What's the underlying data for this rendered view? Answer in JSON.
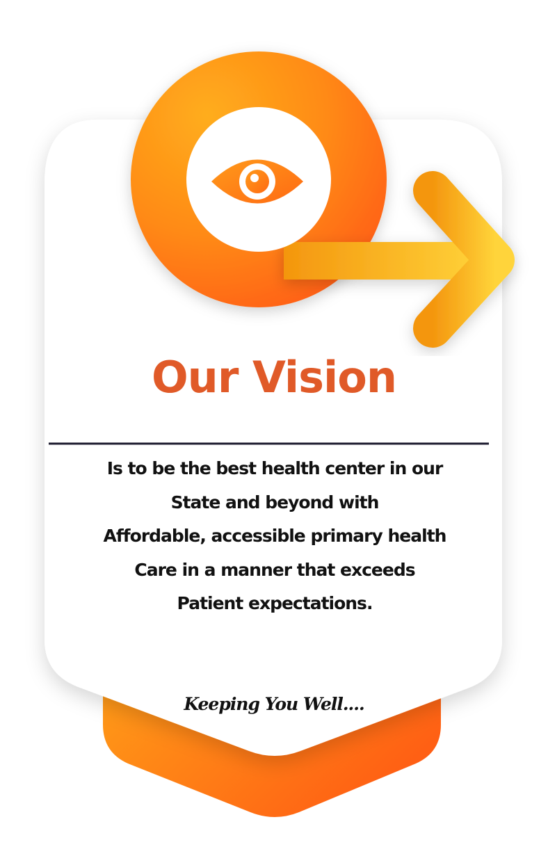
{
  "heading": "Our Vision",
  "statement_lines": [
    "Is to be the best health center in our",
    "State and beyond with",
    "Affordable, accessible primary health",
    "Care in a manner that exceeds",
    "Patient expectations."
  ],
  "tagline": "Keeping You Well....",
  "icons": {
    "main": "eye-icon",
    "arrow": "arrow-right-icon"
  },
  "colors": {
    "heading": "#e05a28",
    "orange_dark": "#ff6a13",
    "orange_light": "#ffa51c",
    "arrow_yellow": "#ffc72c",
    "divider": "#1b1a2e",
    "text": "#111111"
  }
}
